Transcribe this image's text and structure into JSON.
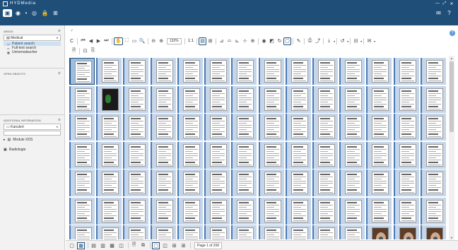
{
  "window": {
    "title": "HYDMedia",
    "minimize_icon": "—",
    "restore_icon": "⤢",
    "close_icon": "✕"
  },
  "appbar": {
    "left_icons": [
      "▣",
      "◉",
      "◎",
      "🔒",
      "⊞"
    ],
    "dropdown_caret": "▾",
    "right_icons": [
      "✉",
      "?"
    ]
  },
  "sidebar": {
    "areas": {
      "heading": "AREAS",
      "selected": "Medical",
      "items": [
        {
          "label": "Patient search",
          "selected": true
        },
        {
          "label": "Full-text search",
          "selected": false
        },
        {
          "label": "Universalsucher",
          "selected": false
        }
      ]
    },
    "open_objects": {
      "heading": "OPEN OBJECTS"
    },
    "additional_information": {
      "heading": "ADDITIONAL INFORMATION",
      "selected": "Kanulert",
      "tree": [
        {
          "label": "Module XDS",
          "expander": "▸"
        },
        {
          "label": "Radiologie",
          "expander": ""
        }
      ]
    },
    "pin_icon": "⊗"
  },
  "toolbar": {
    "zoom_value": "132%",
    "ratio_label": "1:1",
    "groups": [
      [
        "C"
      ],
      [
        "⏮",
        "◀",
        "▶",
        "⏭"
      ],
      [
        "✋",
        "⛶",
        "▭",
        "🔍"
      ],
      [
        "⊖",
        "⊕"
      ],
      [
        "▤",
        "⊞"
      ],
      [
        "⊿",
        "⌓",
        "⊾",
        "⊹",
        "⊕"
      ],
      [
        "◉",
        "◩",
        "↻",
        "▢"
      ],
      [
        "✎"
      ],
      [
        "⎙",
        "⤴"
      ],
      [
        "⤓"
      ],
      [
        "↺"
      ],
      [
        "⊟"
      ],
      [
        "✉"
      ]
    ],
    "row2": [
      "🗎",
      "⊡",
      "⎘"
    ],
    "help_icon": "?"
  },
  "grid": {
    "columns": 14,
    "rows": 7,
    "special": {
      "0": "first",
      "15": "dark",
      "95": "photo",
      "96": "photo",
      "97": "photo"
    }
  },
  "bottombar": {
    "buttons": [
      "▢",
      "▦",
      "▤",
      "▥",
      "▦",
      "◫",
      "🗎",
      "⧉",
      "▢",
      "◫",
      "⊞",
      "⊞"
    ],
    "active_indices": [
      1,
      8
    ],
    "page_info": "Page 1 of 200"
  },
  "colors": {
    "accent": "#1f4e78",
    "thumb": "#c5d6ea"
  }
}
